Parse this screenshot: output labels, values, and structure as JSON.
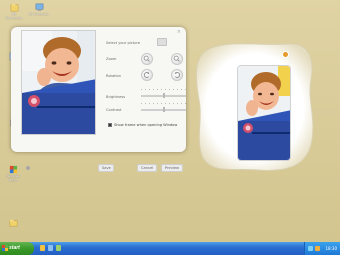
{
  "desktop": {
    "icons": [
      {
        "label": "My Documents",
        "icon": "folder-documents-icon"
      },
      {
        "label": "My Computer",
        "icon": "computer-icon"
      },
      {
        "label": "",
        "icon": "app-icon"
      },
      {
        "label": "",
        "icon": "recycle-icon"
      },
      {
        "label": "Windows Media",
        "icon": "media-icon"
      },
      {
        "label": "Folder",
        "icon": "folder-icon"
      }
    ]
  },
  "dialog": {
    "close_label": "×",
    "select_label": "Select your picture",
    "zoom_label": "Zoom",
    "rotation_label": "Rotation",
    "brightness_label": "Brightness",
    "contrast_label": "Contrast",
    "show_frame_checked": true,
    "show_frame_label": "Show frame when opening Window",
    "save_label": "Save",
    "cancel_label": "Cancel",
    "preview_label": "Preview",
    "brightness_level": 0.5,
    "contrast_level": 0.5
  },
  "taskbar": {
    "start_label": "start",
    "clock": "18:30"
  },
  "colors": {
    "desktop_bg": "#d9cc9a",
    "taskbar_blue": "#245ec3",
    "start_green": "#3a9a2a",
    "accent_orange": "#e79a2c"
  }
}
